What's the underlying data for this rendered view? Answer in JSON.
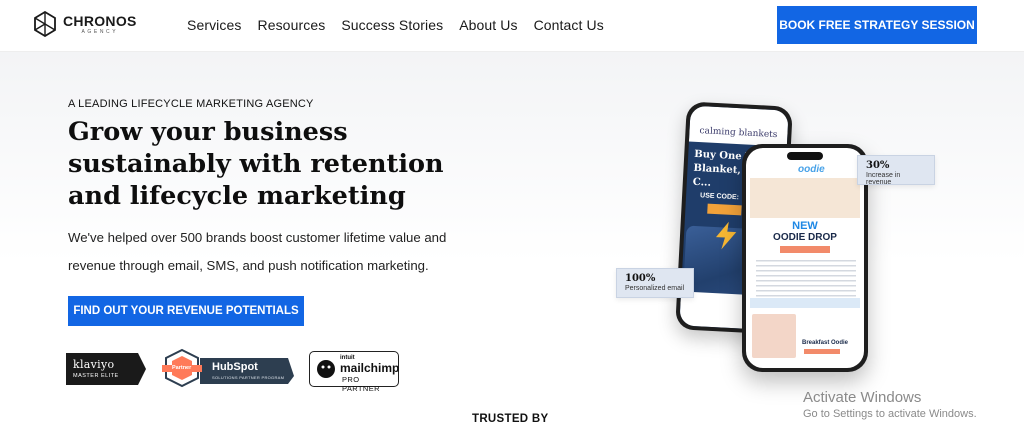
{
  "header": {
    "logo": {
      "name": "CHRONOS",
      "sub": "AGENCY"
    },
    "nav": [
      "Services",
      "Resources",
      "Success Stories",
      "About Us",
      "Contact Us"
    ],
    "cta_label": "BOOK FREE STRATEGY SESSION"
  },
  "hero": {
    "eyebrow": "A LEADING LIFECYCLE MARKETING AGENCY",
    "headline": "Grow your business sustainably with retention and lifecycle marketing",
    "subtext": "We've helped over 500 brands boost customer lifetime value and revenue through email, SMS, and push notification marketing.",
    "cta_label": "FIND OUT YOUR REVENUE POTENTIALS"
  },
  "badges": {
    "klaviyo": {
      "name": "klaviyo",
      "tier": "MASTER ELITE"
    },
    "hubspot": {
      "ribbon": "Partner",
      "name": "HubSpot",
      "program": "SOLUTIONS PARTNER PROGRAM"
    },
    "mailchimp": {
      "brand_top": "intuit",
      "name": "mailchimp",
      "tier": "PRO PARTNER"
    }
  },
  "mockup": {
    "back_phone": {
      "brand": "calming blankets",
      "title": "Buy One We... Blanket, Get C...",
      "code": "USE CODE:"
    },
    "front_phone": {
      "brand": "oodie",
      "headline_1": "NEW",
      "headline_2": "OODIE DROP",
      "bottom_label": "Breakfast Oodie"
    },
    "stat_revenue": {
      "value": "30%",
      "label": "Increase in revenue"
    },
    "stat_email": {
      "value": "100%",
      "label": "Personalized email"
    }
  },
  "trusted_label": "TRUSTED BY",
  "watermark": {
    "title": "Activate Windows",
    "subtitle": "Go to Settings to activate Windows."
  },
  "colors": {
    "accent": "#1266e4",
    "stat_bg": "#dfe6f1"
  }
}
